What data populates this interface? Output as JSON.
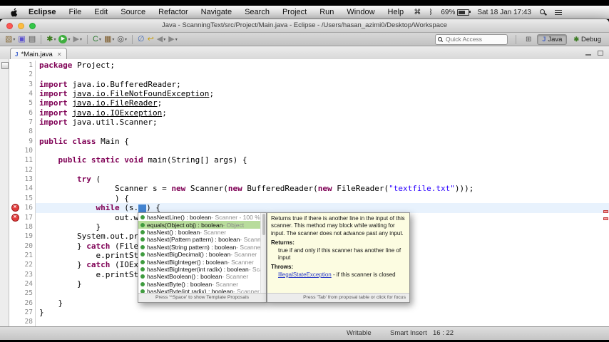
{
  "chrome": {
    "title": "Java - ScanningText/src/Project/Main.java - Eclipse - /Users/hasan_azimi0/Desktop/Workspace",
    "menubar": {
      "items": [
        "Eclipse",
        "File",
        "Edit",
        "Source",
        "Refactor",
        "Navigate",
        "Search",
        "Project",
        "Run",
        "Window",
        "Help"
      ],
      "status": {
        "battery_percent": "69%",
        "datetime": "Sat 18 Jan 17:43"
      }
    }
  },
  "toolbar": {
    "icons": [
      {
        "name": "new-wizard",
        "glyph": "▧",
        "color": "#8a6d3b",
        "dd": true
      },
      {
        "name": "save",
        "glyph": "▣",
        "color": "#5a4fcf"
      },
      {
        "name": "print",
        "glyph": "▤",
        "color": "#555555"
      },
      {
        "sep": true
      },
      {
        "name": "debug",
        "glyph": "✱",
        "color": "#3c7a1e",
        "dd": true
      },
      {
        "name": "run",
        "glyph": "▶",
        "bg": "#3fae3f",
        "color": "#ffffff",
        "dd": true
      },
      {
        "name": "external-tools",
        "glyph": "▶",
        "color": "#888888",
        "dd": true
      },
      {
        "sep": true
      },
      {
        "name": "new-java-class",
        "glyph": "C",
        "color": "#2e7d32",
        "dd": true
      },
      {
        "name": "new-java-project",
        "glyph": "▦",
        "color": "#7d5b2a",
        "dd": true
      },
      {
        "name": "search",
        "glyph": "◎",
        "color": "#444444",
        "dd": true
      },
      {
        "sep": true
      },
      {
        "name": "skip-breakpoints",
        "glyph": "∅",
        "color": "#4a6fb5"
      },
      {
        "name": "last-edit-location",
        "glyph": "↩",
        "color": "#c8a012"
      },
      {
        "name": "back",
        "glyph": "◀",
        "color": "#888888",
        "dd": true
      },
      {
        "name": "forward",
        "glyph": "▶",
        "color": "#888888",
        "dd": true
      }
    ],
    "quick_access": "Quick Access",
    "perspectives": [
      {
        "label": "Java",
        "icon": "J",
        "icon_color": "#4a66c4",
        "active": true
      },
      {
        "label": "Debug",
        "icon": "✱",
        "icon_color": "#3e7d26",
        "active": false
      }
    ]
  },
  "editor": {
    "tab": {
      "title": "*Main.java"
    },
    "lines": [
      {
        "n": "1",
        "segs": [
          [
            "k",
            "package"
          ],
          [
            "p",
            " Project;"
          ]
        ]
      },
      {
        "n": "2",
        "segs": []
      },
      {
        "n": "3",
        "segs": [
          [
            "k",
            "import"
          ],
          [
            "p",
            " java.io.BufferedReader;"
          ]
        ]
      },
      {
        "n": "4",
        "segs": [
          [
            "k",
            "import"
          ],
          [
            "p",
            " "
          ],
          [
            "u",
            "java.io.FileNotFoundException"
          ],
          [
            "p",
            ";"
          ]
        ]
      },
      {
        "n": "5",
        "segs": [
          [
            "k",
            "import"
          ],
          [
            "p",
            " "
          ],
          [
            "u",
            "java.io.FileReader"
          ],
          [
            "p",
            ";"
          ]
        ]
      },
      {
        "n": "6",
        "segs": [
          [
            "k",
            "import"
          ],
          [
            "p",
            " "
          ],
          [
            "u",
            "java.io.IOException"
          ],
          [
            "p",
            ";"
          ]
        ]
      },
      {
        "n": "7",
        "segs": [
          [
            "k",
            "import"
          ],
          [
            "p",
            " java.util.Scanner;"
          ]
        ]
      },
      {
        "n": "8",
        "segs": []
      },
      {
        "n": "9",
        "segs": [
          [
            "k",
            "public"
          ],
          [
            "p",
            " "
          ],
          [
            "k",
            "class"
          ],
          [
            "p",
            " Main {"
          ]
        ]
      },
      {
        "n": "10",
        "segs": []
      },
      {
        "n": "11",
        "segs": [
          [
            "p",
            "    "
          ],
          [
            "k",
            "public"
          ],
          [
            "p",
            " "
          ],
          [
            "k",
            "static"
          ],
          [
            "p",
            " "
          ],
          [
            "k",
            "void"
          ],
          [
            "p",
            " main(String[] args) {"
          ]
        ]
      },
      {
        "n": "12",
        "segs": []
      },
      {
        "n": "13",
        "segs": [
          [
            "p",
            "        "
          ],
          [
            "k",
            "try"
          ],
          [
            "p",
            " ("
          ]
        ]
      },
      {
        "n": "14",
        "segs": [
          [
            "p",
            "                Scanner s = "
          ],
          [
            "k",
            "new"
          ],
          [
            "p",
            " Scanner("
          ],
          [
            "k",
            "new"
          ],
          [
            "p",
            " BufferedReader("
          ],
          [
            "k",
            "new"
          ],
          [
            "p",
            " FileReader("
          ],
          [
            "s",
            "\"textfile.txt\""
          ],
          [
            "p",
            ")));"
          ]
        ]
      },
      {
        "n": "15",
        "segs": [
          [
            "p",
            "                ) {"
          ]
        ]
      },
      {
        "n": "16",
        "segs": [
          [
            "p",
            "            "
          ],
          [
            "k",
            "while"
          ],
          [
            "p",
            " (s."
          ],
          [
            "sel",
            "  "
          ],
          [
            "p",
            ") {"
          ]
        ],
        "error": true,
        "current": true
      },
      {
        "n": "17",
        "segs": [
          [
            "p",
            "                out.w"
          ]
        ],
        "error": true
      },
      {
        "n": "18",
        "segs": [
          [
            "p",
            "            }"
          ]
        ]
      },
      {
        "n": "19",
        "segs": [
          [
            "p",
            "        System.out.pr"
          ]
        ]
      },
      {
        "n": "20",
        "segs": [
          [
            "p",
            "        } "
          ],
          [
            "k",
            "catch"
          ],
          [
            "p",
            " (File"
          ]
        ]
      },
      {
        "n": "21",
        "segs": [
          [
            "p",
            "            e.printSt"
          ]
        ]
      },
      {
        "n": "22",
        "segs": [
          [
            "p",
            "        } "
          ],
          [
            "k",
            "catch"
          ],
          [
            "p",
            " (IOEx"
          ]
        ]
      },
      {
        "n": "23",
        "segs": [
          [
            "p",
            "            e.printSt"
          ]
        ]
      },
      {
        "n": "24",
        "segs": [
          [
            "p",
            "        }"
          ]
        ]
      },
      {
        "n": "25",
        "segs": []
      },
      {
        "n": "26",
        "segs": [
          [
            "p",
            "    }"
          ]
        ]
      },
      {
        "n": "27",
        "segs": [
          [
            "p",
            "}"
          ]
        ]
      },
      {
        "n": "28",
        "segs": []
      }
    ]
  },
  "completion": {
    "items": [
      {
        "label": "hasNextLine() : boolean",
        "detail": "Scanner - 100 %"
      },
      {
        "label": "equals(Object obj) : boolean",
        "detail": "Object",
        "selected": true
      },
      {
        "label": "hasNext() : boolean",
        "detail": "Scanner"
      },
      {
        "label": "hasNext(Pattern pattern) : boolean",
        "detail": "Scanner"
      },
      {
        "label": "hasNext(String pattern) : boolean",
        "detail": "Scanner"
      },
      {
        "label": "hasNextBigDecimal() : boolean",
        "detail": "Scanner"
      },
      {
        "label": "hasNextBigInteger() : boolean",
        "detail": "Scanner"
      },
      {
        "label": "hasNextBigInteger(int radix) : boolean",
        "detail": "Scanner"
      },
      {
        "label": "hasNextBoolean() : boolean",
        "detail": "Scanner"
      },
      {
        "label": "hasNextByte() : boolean",
        "detail": "Scanner"
      },
      {
        "label": "hasNextByte(int radix) : boolean",
        "detail": "Scanner"
      }
    ],
    "footer": "Press '^Space' to show Template Proposals"
  },
  "javadoc": {
    "description": "Returns true if there is another line in the input of this scanner. This method may block while waiting for input. The scanner does not advance past any input.",
    "returns_label": "Returns:",
    "returns_text": "true if and only if this scanner has another line of input",
    "throws_label": "Throws:",
    "throws_link": "IllegalStateException",
    "throws_text": " - if this scanner is closed",
    "footer": "Press 'Tab' from proposal table or click for focus"
  },
  "statusbar": {
    "writable": "Writable",
    "insert_mode": "Smart Insert",
    "caret": "16 : 22"
  }
}
